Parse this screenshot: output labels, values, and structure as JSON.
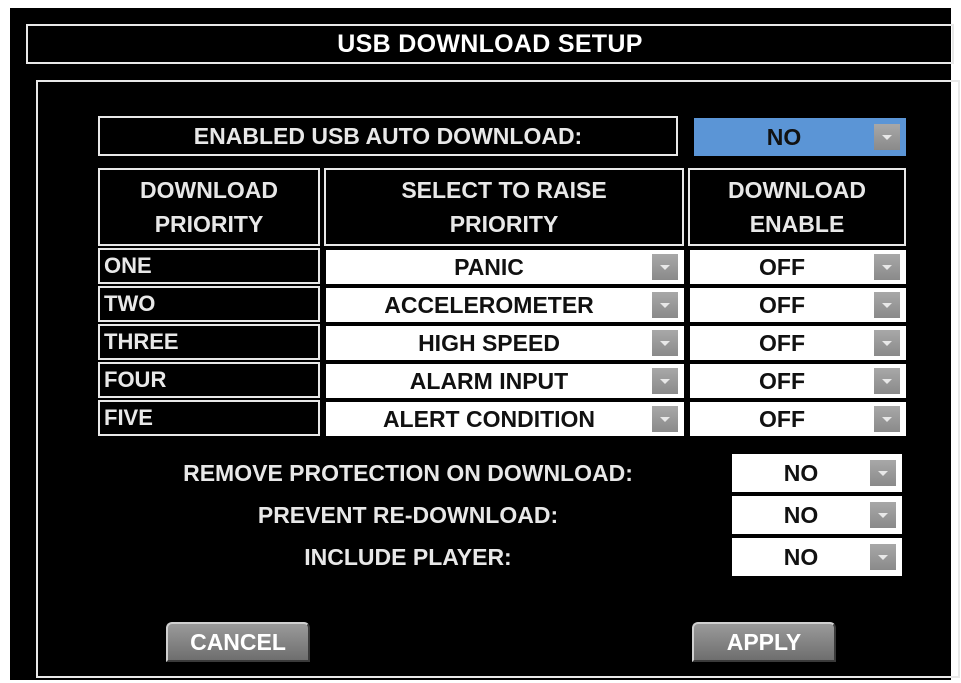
{
  "title": "USB DOWNLOAD SETUP",
  "auto_download": {
    "label": "ENABLED USB AUTO DOWNLOAD:",
    "value": "NO"
  },
  "table": {
    "headers": {
      "priority": [
        "DOWNLOAD",
        "PRIORITY"
      ],
      "select": [
        "SELECT TO RAISE",
        "PRIORITY"
      ],
      "enable": [
        "DOWNLOAD",
        "ENABLE"
      ]
    },
    "rows": [
      {
        "priority": "ONE",
        "event": "PANIC",
        "enable": "OFF"
      },
      {
        "priority": "TWO",
        "event": "ACCELEROMETER",
        "enable": "OFF"
      },
      {
        "priority": "THREE",
        "event": "HIGH SPEED",
        "enable": "OFF"
      },
      {
        "priority": "FOUR",
        "event": "ALARM INPUT",
        "enable": "OFF"
      },
      {
        "priority": "FIVE",
        "event": "ALERT CONDITION",
        "enable": "OFF"
      }
    ]
  },
  "options": [
    {
      "label": "REMOVE PROTECTION ON DOWNLOAD:",
      "value": "NO"
    },
    {
      "label": "PREVENT RE-DOWNLOAD:",
      "value": "NO"
    },
    {
      "label": "INCLUDE PLAYER:",
      "value": "NO"
    }
  ],
  "buttons": {
    "cancel": "CANCEL",
    "apply": "APPLY"
  },
  "colors": {
    "background": "#000000",
    "highlight": "#5b95d6",
    "dropdown_arrow": "#999999",
    "text": "#e8e8e8"
  }
}
